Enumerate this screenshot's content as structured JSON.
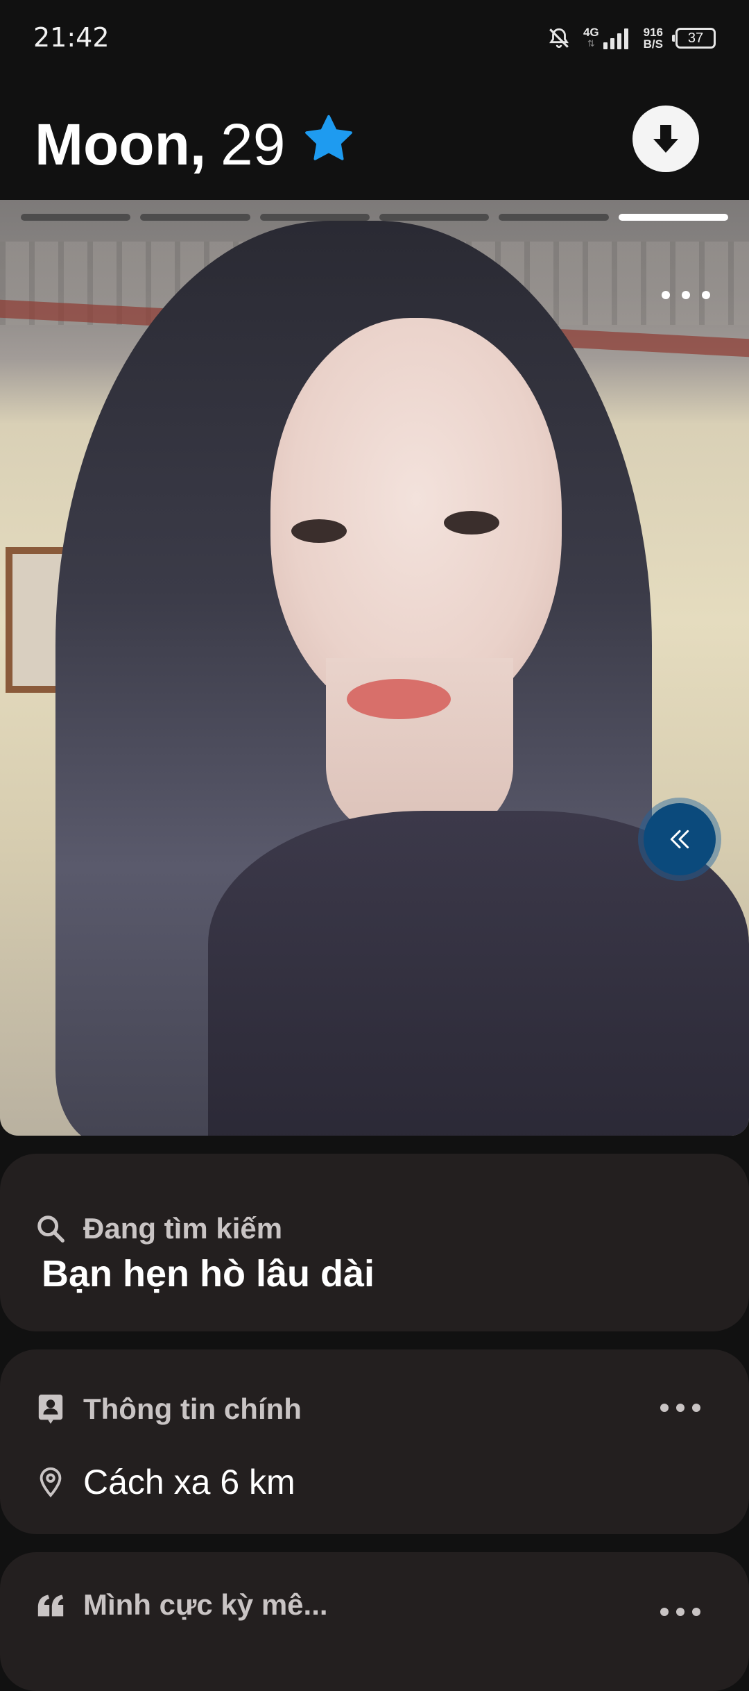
{
  "status_bar": {
    "time": "21:42",
    "network": "4G",
    "speed_value": "916",
    "speed_unit": "B/S",
    "battery": "37",
    "icons": [
      "bell-off-icon",
      "signal-icon"
    ]
  },
  "profile": {
    "name": "Moon,",
    "age": "29",
    "badge_icon": "star-icon",
    "badge_color": "#1e9bf0"
  },
  "photo": {
    "progress": {
      "count": 6,
      "active_index": 5
    }
  },
  "looking_for": {
    "heading": "Đang tìm kiếm",
    "value": "Bạn hẹn hò lâu dài"
  },
  "basics": {
    "heading": "Thông tin chính",
    "distance": "Cách xa 6 km"
  },
  "about": {
    "heading": "Mình cực kỳ mê..."
  },
  "colors": {
    "background": "#111111",
    "card": "#231f1f",
    "rewind_button": "#0b4a7c"
  }
}
